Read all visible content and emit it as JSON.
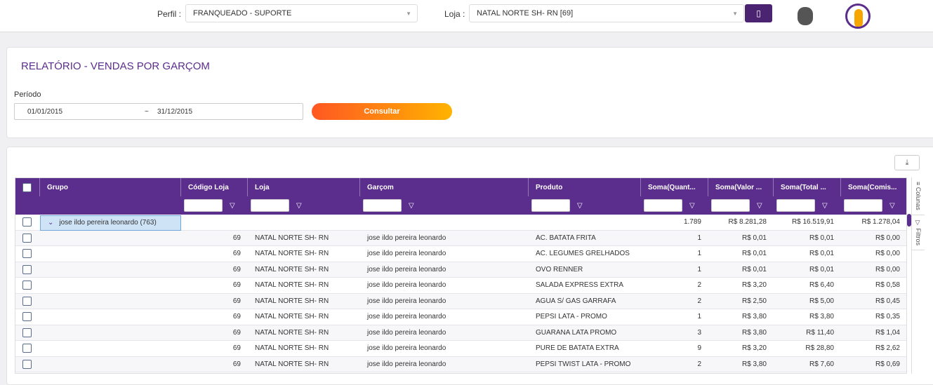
{
  "top": {
    "perfil_label": "Perfil :",
    "perfil_value": "FRANQUEADO - SUPORTE",
    "loja_label": "Loja :",
    "loja_value": "NATAL NORTE SH- RN [69]"
  },
  "report": {
    "title": "RELATÓRIO - VENDAS POR GARÇOM",
    "period_label": "Período",
    "date_from": "01/01/2015",
    "date_sep": "~",
    "date_to": "31/12/2015",
    "submit": "Consultar"
  },
  "grid": {
    "columns": [
      "Grupo",
      "Código Loja",
      "Loja",
      "Garçom",
      "Produto",
      "Soma(Quant...",
      "Soma(Valor ...",
      "Soma(Total ...",
      "Soma(Comis..."
    ],
    "group": {
      "label": "jose ildo pereira leonardo (763)",
      "qty": "1.789",
      "valor": "R$ 8.281,28",
      "total": "R$ 16.519,91",
      "comissao": "R$ 1.278,04"
    },
    "rows": [
      [
        "69",
        "NATAL NORTE SH- RN",
        "jose ildo pereira leonardo",
        "AC. BATATA FRITA",
        "1",
        "R$ 0,01",
        "R$ 0,01",
        "R$ 0,00"
      ],
      [
        "69",
        "NATAL NORTE SH- RN",
        "jose ildo pereira leonardo",
        "AC. LEGUMES GRELHADOS",
        "1",
        "R$ 0,01",
        "R$ 0,01",
        "R$ 0,00"
      ],
      [
        "69",
        "NATAL NORTE SH- RN",
        "jose ildo pereira leonardo",
        "OVO RENNER",
        "1",
        "R$ 0,01",
        "R$ 0,01",
        "R$ 0,00"
      ],
      [
        "69",
        "NATAL NORTE SH- RN",
        "jose ildo pereira leonardo",
        "SALADA EXPRESS EXTRA",
        "2",
        "R$ 3,20",
        "R$ 6,40",
        "R$ 0,58"
      ],
      [
        "69",
        "NATAL NORTE SH- RN",
        "jose ildo pereira leonardo",
        "AGUA S/ GAS GARRAFA",
        "2",
        "R$ 2,50",
        "R$ 5,00",
        "R$ 0,45"
      ],
      [
        "69",
        "NATAL NORTE SH- RN",
        "jose ildo pereira leonardo",
        "PEPSI LATA - PROMO",
        "1",
        "R$ 3,80",
        "R$ 3,80",
        "R$ 0,35"
      ],
      [
        "69",
        "NATAL NORTE SH- RN",
        "jose ildo pereira leonardo",
        "GUARANA LATA PROMO",
        "3",
        "R$ 3,80",
        "R$ 11,40",
        "R$ 1,04"
      ],
      [
        "69",
        "NATAL NORTE SH- RN",
        "jose ildo pereira leonardo",
        "PURE DE BATATA EXTRA",
        "9",
        "R$ 3,20",
        "R$ 28,80",
        "R$ 2,62"
      ],
      [
        "69",
        "NATAL NORTE SH- RN",
        "jose ildo pereira leonardo",
        "PEPSI TWIST LATA - PROMO",
        "2",
        "R$ 3,80",
        "R$ 7,60",
        "R$ 0,69"
      ]
    ],
    "side_columns": "Colunas",
    "side_filters": "Filtros"
  },
  "colors": {
    "primary": "#5b2d8c",
    "button_from": "#ff5722",
    "button_to": "#ffb300"
  }
}
